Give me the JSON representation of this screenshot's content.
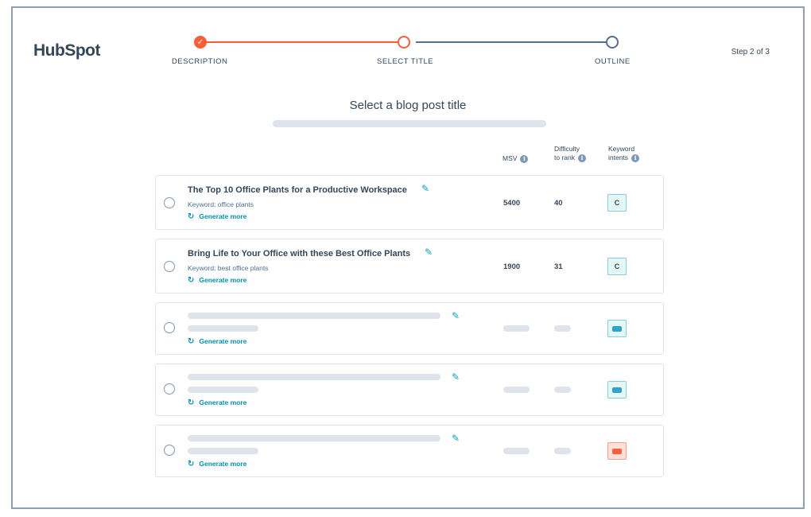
{
  "brand": {
    "logo_text": "HubSpot"
  },
  "stepper": {
    "steps": [
      {
        "label": "DESCRIPTION",
        "state": "completed"
      },
      {
        "label": "SELECT TITLE",
        "state": "active"
      },
      {
        "label": "OUTLINE",
        "state": "pending"
      }
    ],
    "step_count": "Step 2 of 3",
    "done_mark": "✓"
  },
  "main": {
    "heading": "Select a blog post title",
    "columns": {
      "msv": "MSV",
      "difficulty_line1": "Difficulty",
      "difficulty_line2": "to rank",
      "intent_line1": "Keyword",
      "intent_line2": "intents",
      "info_glyph": "i"
    },
    "rows": [
      {
        "title": "The Top 10 Office Plants for a Productive Workspace",
        "keyword": "Keyword: office plants",
        "generate": "Generate more",
        "msv": "5400",
        "difficulty": "40",
        "intent": "C"
      },
      {
        "title": "Bring Life to Your Office with these Best Office Plants",
        "keyword": "Keyword: best office plants",
        "generate": "Generate more",
        "msv": "1900",
        "difficulty": "31",
        "intent": "C"
      },
      {
        "generate": "Generate more",
        "loading": true,
        "intent_color": "#2fa3c9"
      },
      {
        "generate": "Generate more",
        "loading": true,
        "intent_color": "#2fa3c9"
      },
      {
        "generate": "Generate more",
        "loading": true,
        "intent_color": "#f2603c"
      }
    ]
  },
  "icons": {
    "pencil": "✎",
    "refresh": "↻"
  },
  "colors": {
    "accent": "#ff5c35",
    "link": "#0091ae",
    "text": "#33475b",
    "placeholder": "#dfe3eb"
  }
}
